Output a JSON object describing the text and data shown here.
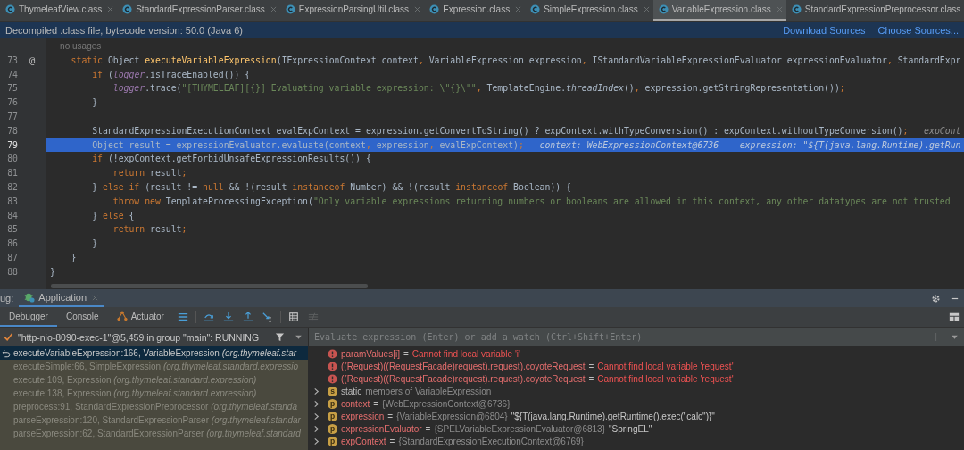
{
  "editor_tabs": [
    {
      "label": "ThymeleafView.class",
      "selected": false
    },
    {
      "label": "StandardExpressionParser.class",
      "selected": false
    },
    {
      "label": "ExpressionParsingUtil.class",
      "selected": false
    },
    {
      "label": "Expression.class",
      "selected": false
    },
    {
      "label": "SimpleExpression.class",
      "selected": false
    },
    {
      "label": "VariableExpression.class",
      "selected": true
    },
    {
      "label": "StandardExpressionPreprocessor.class",
      "selected": false
    }
  ],
  "info_bar": {
    "message": "Decompiled .class file, bytecode version: 50.0 (Java 6)",
    "links": [
      "Download Sources",
      "Choose Sources..."
    ]
  },
  "code_lines": [
    {
      "selected": false,
      "tokens": [
        {
          "kind": "inlay",
          "text": "    no usages"
        }
      ]
    },
    {
      "number": "73",
      "gutter": "@",
      "selected": false,
      "tokens": [
        {
          "kind": "kw",
          "text": "    static "
        },
        {
          "kind": "plain",
          "text": "Object "
        },
        {
          "kind": "fn",
          "text": "executeVariableExpression"
        },
        {
          "kind": "plain",
          "text": "(IExpressionContext context"
        },
        {
          "kind": "kw",
          "text": ", "
        },
        {
          "kind": "plain",
          "text": "VariableExpression expression"
        },
        {
          "kind": "kw",
          "text": ", "
        },
        {
          "kind": "plain",
          "text": "IStandardVariableExpressionEvaluator expressionEvaluator"
        },
        {
          "kind": "kw",
          "text": ", "
        },
        {
          "kind": "plain",
          "text": "StandardExpr"
        }
      ]
    },
    {
      "number": "74",
      "selected": false,
      "tokens": [
        {
          "kind": "kw",
          "text": "        if "
        },
        {
          "kind": "plain",
          "text": "("
        },
        {
          "kind": "field",
          "text": "logger"
        },
        {
          "kind": "plain",
          "text": ".isTraceEnabled()) {"
        }
      ]
    },
    {
      "number": "75",
      "selected": false,
      "tokens": [
        {
          "kind": "field",
          "text": "            logger"
        },
        {
          "kind": "plain",
          "text": ".trace("
        },
        {
          "kind": "str",
          "text": "\"[THYMELEAF][{}] Evaluating variable expression: \\\"{}\\\"\""
        },
        {
          "kind": "kw",
          "text": ", "
        },
        {
          "kind": "plain",
          "text": "TemplateEngine."
        },
        {
          "kind": "italic",
          "text": "threadIndex"
        },
        {
          "kind": "plain",
          "text": "()"
        },
        {
          "kind": "kw",
          "text": ", "
        },
        {
          "kind": "plain",
          "text": "expression.getStringRepresentation())"
        },
        {
          "kind": "kw",
          "text": ";"
        }
      ]
    },
    {
      "number": "76",
      "selected": false,
      "tokens": [
        {
          "kind": "plain",
          "text": "        }"
        }
      ]
    },
    {
      "number": "77",
      "selected": false
    },
    {
      "number": "78",
      "selected": false,
      "tokens": [
        {
          "kind": "plain",
          "text": "        StandardExpressionExecutionContext evalExpContext = expression.getConvertToString() ? expContext.withTypeConversion() : expContext.withoutTypeConversion()"
        },
        {
          "kind": "kw",
          "text": ";"
        },
        {
          "kind": "hint",
          "text": "   expCont"
        }
      ]
    },
    {
      "number": "79",
      "selected": true,
      "tokens": [
        {
          "kind": "plain",
          "text": "        Object result = expressionEvaluator.evaluate(context"
        },
        {
          "kind": "kw",
          "text": ", "
        },
        {
          "kind": "plain",
          "text": "expression"
        },
        {
          "kind": "kw",
          "text": ", "
        },
        {
          "kind": "plain",
          "text": "evalExpContext)"
        },
        {
          "kind": "kw",
          "text": ";"
        },
        {
          "kind": "hint",
          "text": "   context: WebExpressionContext@6736    expression: \"${T(java.lang.Runtime).getRun"
        }
      ]
    },
    {
      "number": "80",
      "selected": false,
      "tokens": [
        {
          "kind": "kw",
          "text": "        if "
        },
        {
          "kind": "plain",
          "text": "(!expContext.getForbidUnsafeExpressionResults()) {"
        }
      ]
    },
    {
      "number": "81",
      "selected": false,
      "tokens": [
        {
          "kind": "kw",
          "text": "            return "
        },
        {
          "kind": "plain",
          "text": "result"
        },
        {
          "kind": "kw",
          "text": ";"
        }
      ]
    },
    {
      "number": "82",
      "selected": false,
      "tokens": [
        {
          "kind": "plain",
          "text": "        } "
        },
        {
          "kind": "kw",
          "text": "else if "
        },
        {
          "kind": "plain",
          "text": "(result != "
        },
        {
          "kind": "kw",
          "text": "null "
        },
        {
          "kind": "plain",
          "text": "&& !(result "
        },
        {
          "kind": "kw",
          "text": "instanceof "
        },
        {
          "kind": "plain",
          "text": "Number) && !(result "
        },
        {
          "kind": "kw",
          "text": "instanceof "
        },
        {
          "kind": "plain",
          "text": "Boolean)) {"
        }
      ]
    },
    {
      "number": "83",
      "selected": false,
      "tokens": [
        {
          "kind": "kw",
          "text": "            throw new "
        },
        {
          "kind": "plain",
          "text": "TemplateProcessingException("
        },
        {
          "kind": "str",
          "text": "\"Only variable expressions returning numbers or booleans are allowed in this context, any other datatypes are not trusted"
        }
      ]
    },
    {
      "number": "84",
      "selected": false,
      "tokens": [
        {
          "kind": "plain",
          "text": "        } "
        },
        {
          "kind": "kw",
          "text": "else "
        },
        {
          "kind": "plain",
          "text": "{"
        }
      ]
    },
    {
      "number": "85",
      "selected": false,
      "tokens": [
        {
          "kind": "kw",
          "text": "            return "
        },
        {
          "kind": "plain",
          "text": "result"
        },
        {
          "kind": "kw",
          "text": ";"
        }
      ]
    },
    {
      "number": "86",
      "selected": false,
      "tokens": [
        {
          "kind": "plain",
          "text": "        }"
        }
      ]
    },
    {
      "number": "87",
      "selected": false,
      "tokens": [
        {
          "kind": "plain",
          "text": "    }"
        }
      ]
    },
    {
      "number": "88",
      "selected": false,
      "tokens": [
        {
          "kind": "plain",
          "text": "}"
        }
      ]
    }
  ],
  "debug": {
    "label": "ug:",
    "session_tab": "Application",
    "tabs": [
      {
        "label": "Debugger",
        "selected": true,
        "kind": "plain"
      },
      {
        "label": "Console",
        "selected": false,
        "kind": "plain"
      },
      {
        "label": "Actuator",
        "selected": false,
        "kind": "actuator"
      }
    ],
    "thread": "\"http-nio-8090-exec-1\"@5,459 in group \"main\": RUNNING",
    "evaluate_placeholder": "Evaluate expression (Enter) or add a watch (Ctrl+Shift+Enter)",
    "frames": [
      {
        "method": "executeVariableExpression:166, VariableExpression",
        "package": "(org.thymeleaf.star",
        "selected": true
      },
      {
        "method": "executeSimple:66, SimpleExpression",
        "package": "(org.thymeleaf.standard.expressio",
        "selected": false
      },
      {
        "method": "execute:109, Expression",
        "package": "(org.thymeleaf.standard.expression)",
        "selected": false
      },
      {
        "method": "execute:138, Expression",
        "package": "(org.thymeleaf.standard.expression)",
        "selected": false
      },
      {
        "method": "preprocess:91, StandardExpressionPreprocessor",
        "package": "(org.thymeleaf.standa",
        "selected": false
      },
      {
        "method": "parseExpression:120, StandardExpressionParser",
        "package": "(org.thymeleaf.standar",
        "selected": false
      },
      {
        "method": "parseExpression:62, StandardExpressionParser",
        "package": "(org.thymeleaf.standard",
        "selected": false
      }
    ],
    "variables": [
      {
        "kind": "watch",
        "name": "paramValues[i]",
        "op": "=",
        "value": "Cannot find local variable 'i'"
      },
      {
        "kind": "watch",
        "name": "((Request)((RequestFacade)request).request).coyoteRequest",
        "op": "=",
        "value": "Cannot find local variable 'request'"
      },
      {
        "kind": "watch",
        "name": "((Request)((RequestFacade)request).request).coyoteRequest",
        "op": "=",
        "value": "Cannot find local variable 'request'"
      },
      {
        "kind": "static",
        "badge": "s",
        "name": "static",
        "value": "members of VariableExpression"
      },
      {
        "kind": "var",
        "badge": "p",
        "name": "context",
        "op": "=",
        "value": "{WebExpressionContext@6736}"
      },
      {
        "kind": "var",
        "badge": "p",
        "name": "expression",
        "op": "=",
        "value": "{VariableExpression@6804}",
        "detail": "\"${T(java.lang.Runtime).getRuntime().exec(\"calc\")}\""
      },
      {
        "kind": "var",
        "badge": "p",
        "name": "expressionEvaluator",
        "op": "=",
        "value": "{SPELVariableExpressionEvaluator@6813}",
        "detail": "\"SpringEL\""
      },
      {
        "kind": "var",
        "badge": "p",
        "name": "expContext",
        "op": "=",
        "value": "{StandardExpressionExecutionContext@6769}"
      }
    ]
  }
}
